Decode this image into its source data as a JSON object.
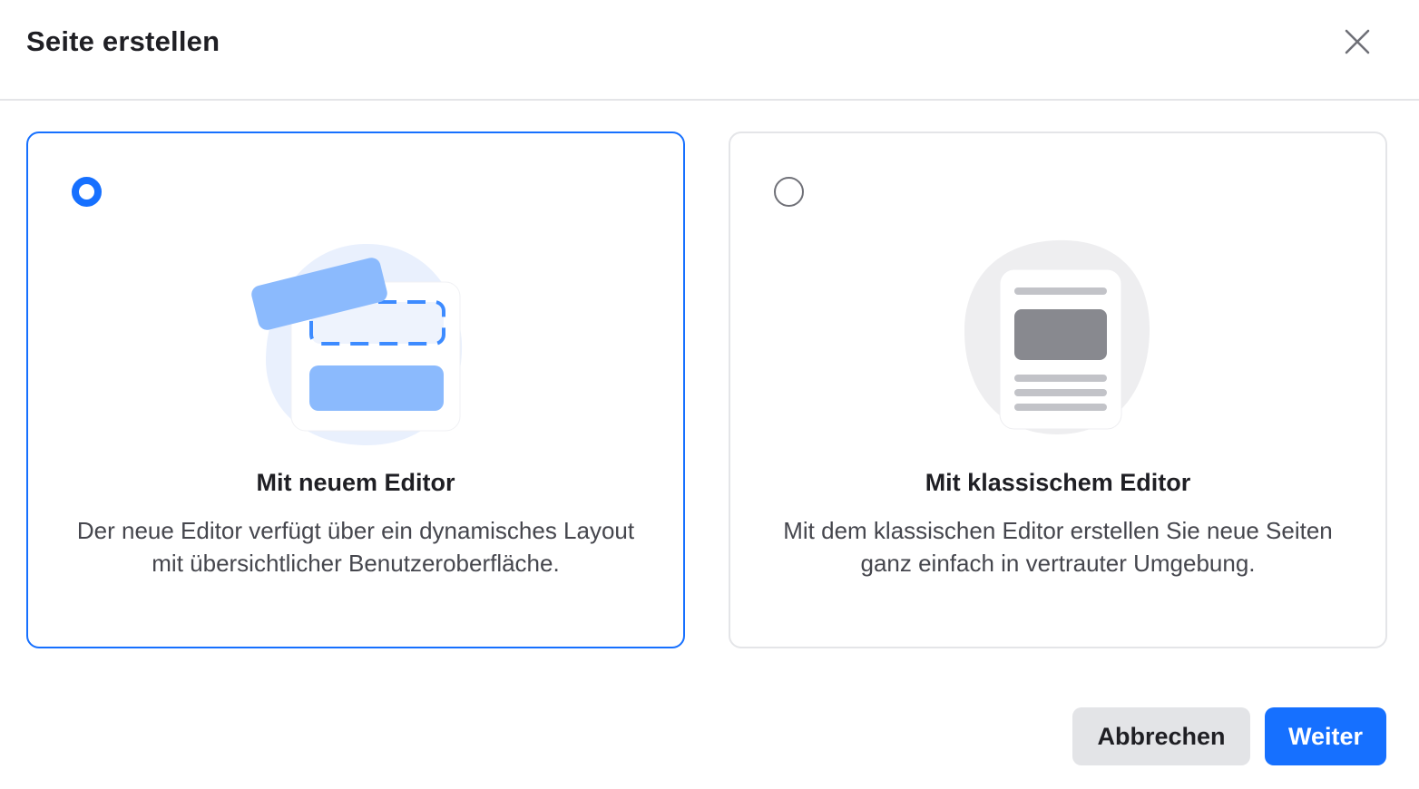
{
  "dialog": {
    "title": "Seite erstellen",
    "close_icon": "close-icon"
  },
  "options": [
    {
      "id": "new-editor",
      "selected": true,
      "title": "Mit neuem Editor",
      "description": "Der neue Editor verfügt über ein dynamisches Layout mit übersichtlicher Benutzeroberfläche.",
      "illustration": "new-editor-illustration"
    },
    {
      "id": "classic-editor",
      "selected": false,
      "title": "Mit klassischem Editor",
      "description": "Mit dem klassischen Editor erstellen Sie neue Seiten ganz einfach in vertrauter Umgebung.",
      "illustration": "classic-editor-illustration"
    }
  ],
  "footer": {
    "cancel_label": "Abbrechen",
    "next_label": "Weiter"
  },
  "colors": {
    "accent": "#1670ff",
    "border": "#e4e5e8",
    "cancel_bg": "#e3e4e7"
  }
}
